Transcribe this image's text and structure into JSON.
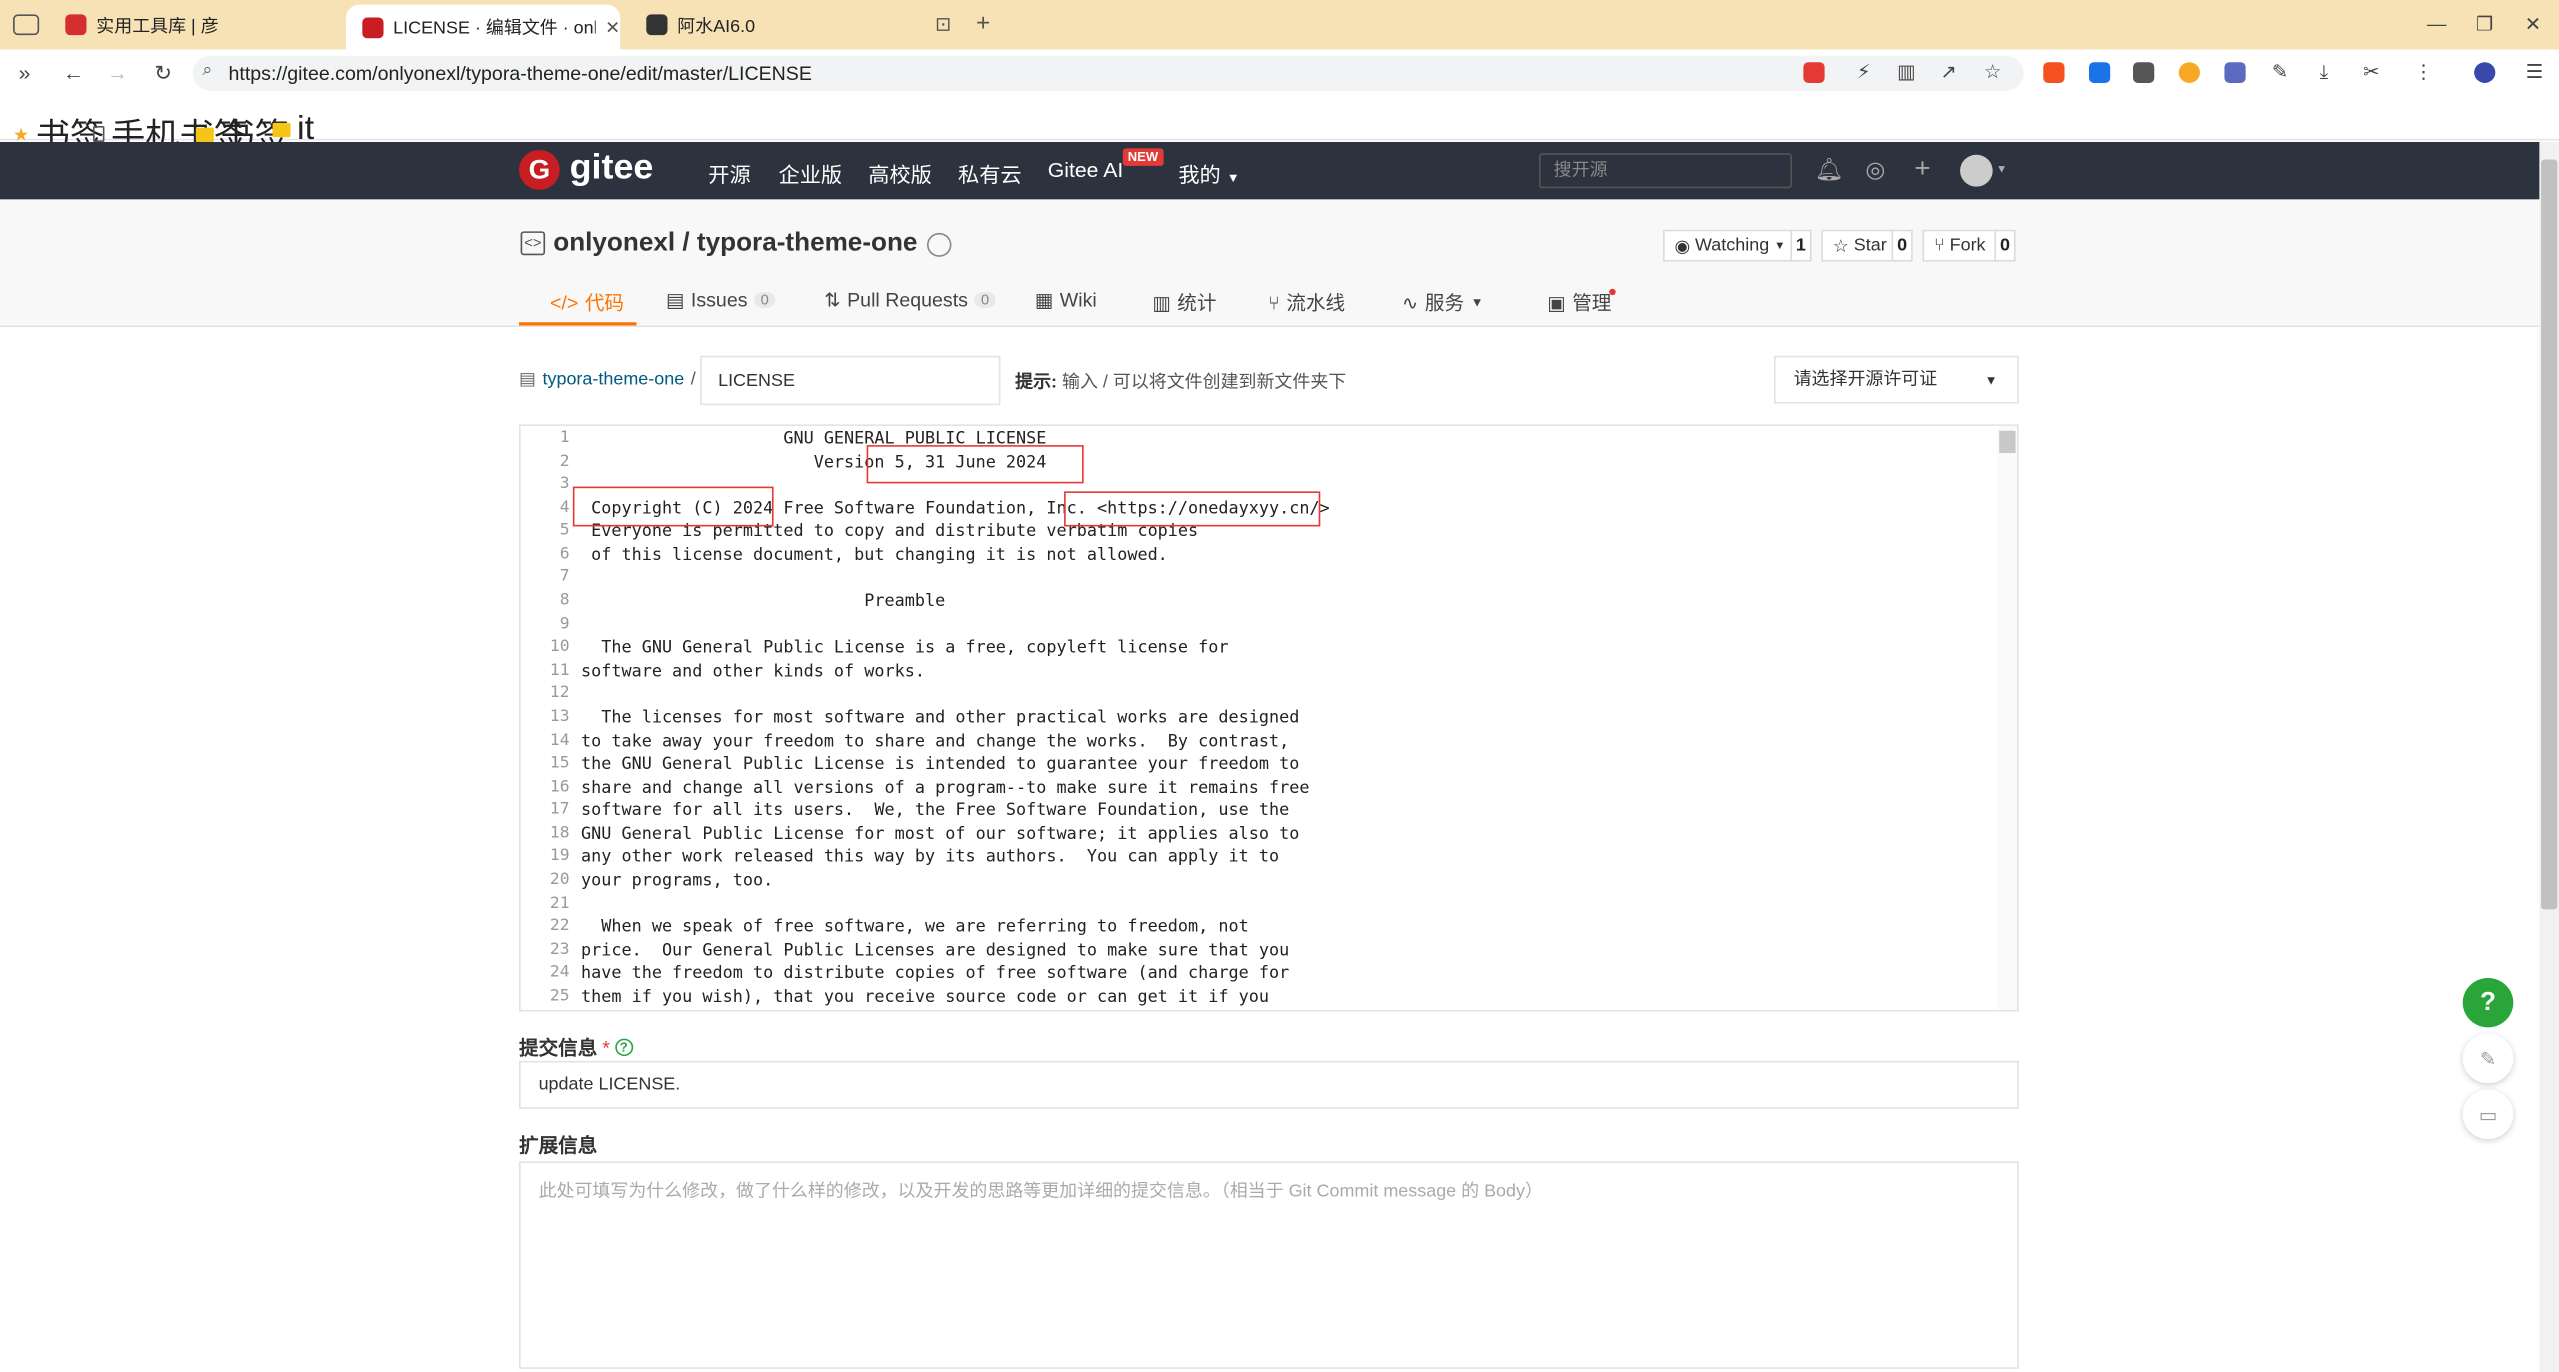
{
  "browser": {
    "tabs": [
      {
        "title": "实用工具库 | 彦",
        "favicon_color": "#d32f2f"
      },
      {
        "title": "LICENSE · 编辑文件 · onlyone",
        "favicon_color": "#c71d23"
      },
      {
        "title": "阿水AI6.0",
        "favicon_color": "#333333"
      }
    ],
    "url": "https://gitee.com/onlyonexl/typora-theme-one/edit/master/LICENSE",
    "bookmarks": [
      {
        "label": "书签",
        "icon": "star-icon"
      },
      {
        "label": "手机书签",
        "icon": "phone-icon"
      },
      {
        "label": "书签",
        "icon": "folder-icon"
      },
      {
        "label": "it",
        "icon": "folder-icon"
      }
    ]
  },
  "gitee": {
    "logo_text": "gitee",
    "nav": [
      "开源",
      "企业版",
      "高校版",
      "私有云",
      "Gitee AI",
      "我的"
    ],
    "new_badge": "NEW",
    "search_placeholder": "搜开源"
  },
  "repo": {
    "owner": "onlyonexl",
    "separator": " / ",
    "name": "typora-theme-one",
    "watch_label": "Watching",
    "watch_count": "1",
    "star_label": "Star",
    "star_count": "0",
    "fork_label": "Fork",
    "fork_count": "0",
    "tabs": {
      "code": "代码",
      "issues": "Issues",
      "issues_count": "0",
      "pulls": "Pull Requests",
      "pulls_count": "0",
      "wiki": "Wiki",
      "stats": "统计",
      "pipeline": "流水线",
      "services": "服务",
      "manage": "管理"
    }
  },
  "editor": {
    "breadcrumb_repo": "typora-theme-one",
    "breadcrumb_sep": "/",
    "filename": "LICENSE",
    "hint_label": "提示:",
    "hint_text": " 输入 / 可以将文件创建到新文件夹下",
    "license_select": "请选择开源许可证",
    "lines": [
      "                    GNU GENERAL PUBLIC LICENSE",
      "                       Version 5, 31 June 2024",
      "",
      " Copyright (C) 2024 Free Software Foundation, Inc. <https://onedayxyy.cn/>",
      " Everyone is permitted to copy and distribute verbatim copies",
      " of this license document, but changing it is not allowed.",
      "",
      "                            Preamble",
      "",
      "  The GNU General Public License is a free, copyleft license for",
      "software and other kinds of works.",
      "",
      "  The licenses for most software and other practical works are designed",
      "to take away your freedom to share and change the works.  By contrast,",
      "the GNU General Public License is intended to guarantee your freedom to",
      "share and change all versions of a program--to make sure it remains free",
      "software for all its users.  We, the Free Software Foundation, use the",
      "GNU General Public License for most of our software; it applies also to",
      "any other work released this way by its authors.  You can apply it to",
      "your programs, too.",
      "",
      "  When we speak of free software, we are referring to freedom, not",
      "price.  Our General Public Licenses are designed to make sure that you",
      "have the freedom to distribute copies of free software (and charge for",
      "them if you wish), that you receive source code or can get it if you"
    ]
  },
  "commit": {
    "label": "提交信息",
    "required_mark": "*",
    "value": "update LICENSE.",
    "ext_label": "扩展信息",
    "ext_placeholder": "此处可填写为什么修改，做了什么样的修改，以及开发的思路等更加详细的提交信息。（相当于 Git Commit message 的 Body）"
  },
  "floating": {
    "help": "?"
  },
  "colors": {
    "brand_red": "#c71d23",
    "accent_orange": "#fe7300",
    "header_bg": "#2d323f",
    "help_green": "#2aa53a",
    "annotation_red": "#e53935"
  }
}
